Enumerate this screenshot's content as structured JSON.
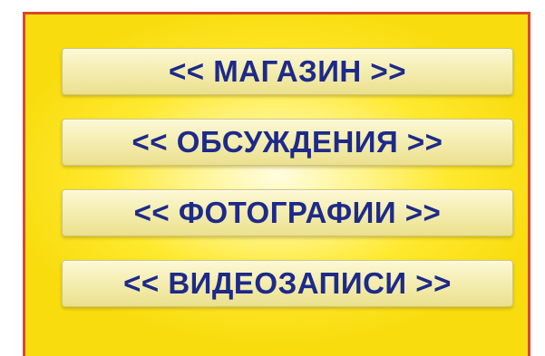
{
  "menu": {
    "items": [
      {
        "label": "<< МАГАЗИН >>"
      },
      {
        "label": "<< ОБСУЖДЕНИЯ >>"
      },
      {
        "label": "<< ФОТОГРАФИИ >>"
      },
      {
        "label": "<< ВИДЕОЗАПИСИ >>"
      }
    ]
  },
  "colors": {
    "frame_border": "#d9482b",
    "background": "#ffe92e",
    "button_face": "#f5eeb3",
    "button_text": "#1d2a8a"
  }
}
